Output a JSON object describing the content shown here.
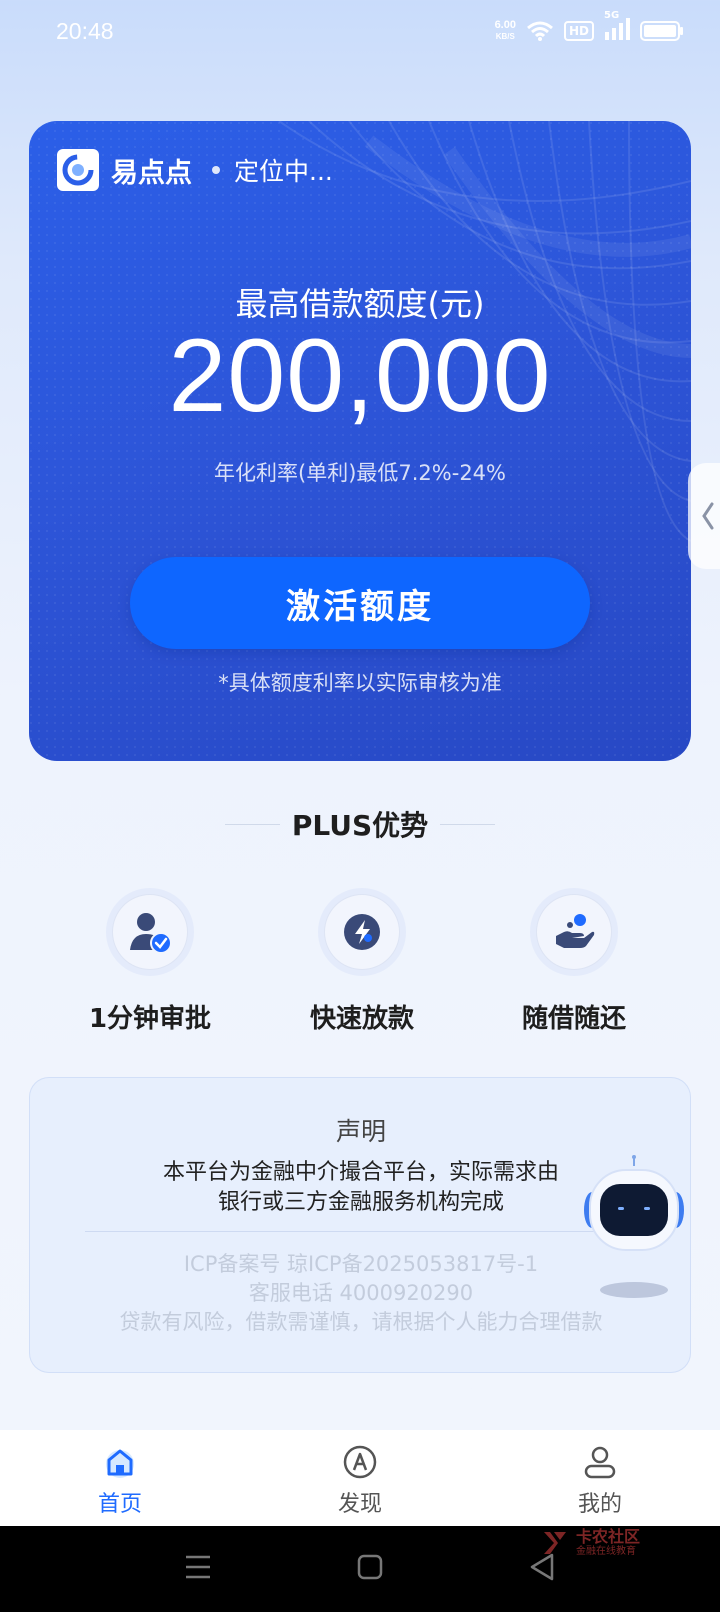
{
  "status_bar": {
    "time": "20:48",
    "net_speed_value": "6.00",
    "net_speed_unit": "KB/S",
    "hd_label": "HD",
    "network_label": "5G",
    "icons": [
      "wifi-icon",
      "signal-icon",
      "battery-icon"
    ]
  },
  "hero": {
    "app_name": "易点点",
    "location": "定位中...",
    "limit_label": "最高借款额度(元)",
    "limit_amount": "200,000",
    "rate": "年化利率(单利)最低7.2%-24%",
    "activate_label": "激活额度",
    "note": "*具体额度利率以实际审核为准"
  },
  "plus": {
    "title": "PLUS优势",
    "features": [
      {
        "label": "1分钟审批",
        "icon": "user-check-icon"
      },
      {
        "label": "快速放款",
        "icon": "lightning-icon"
      },
      {
        "label": "随借随还",
        "icon": "hand-coin-icon"
      }
    ]
  },
  "statement": {
    "title": "声明",
    "body_line1": "本平台为金融中介撮合平台，实际需求由",
    "body_line2": "银行或三方金融服务机构完成",
    "icp": "ICP备案号 琼ICP备2025053817号-1",
    "phone": "客服电话 4000920290",
    "risk": "贷款有风险，借款需谨慎，请根据个人能力合理借款"
  },
  "bottom_nav": {
    "items": [
      {
        "label": "首页",
        "icon": "home-icon",
        "active": true
      },
      {
        "label": "发现",
        "icon": "compass-icon",
        "active": false
      },
      {
        "label": "我的",
        "icon": "user-icon",
        "active": false
      }
    ]
  },
  "watermark": {
    "main": "卡农社区",
    "sub": "金融在线教育"
  },
  "colors": {
    "hero_blue": "#2b5fe8",
    "button_blue": "#0e66ff",
    "nav_active": "#1f6bff"
  }
}
